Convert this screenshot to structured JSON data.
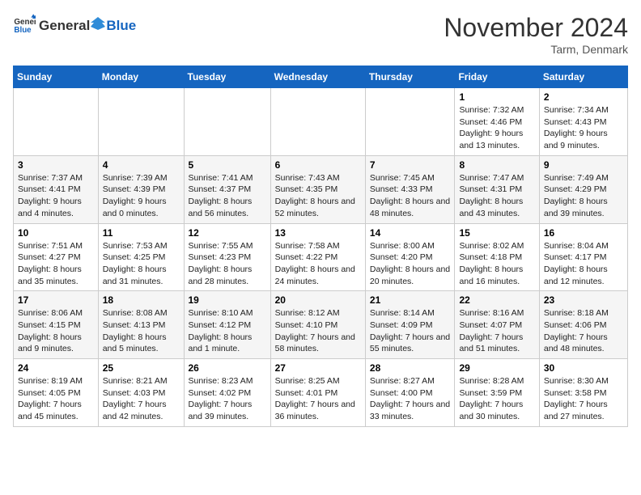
{
  "header": {
    "logo_general": "General",
    "logo_blue": "Blue",
    "month_title": "November 2024",
    "location": "Tarm, Denmark"
  },
  "days_of_week": [
    "Sunday",
    "Monday",
    "Tuesday",
    "Wednesday",
    "Thursday",
    "Friday",
    "Saturday"
  ],
  "weeks": [
    [
      {
        "day": "",
        "info": ""
      },
      {
        "day": "",
        "info": ""
      },
      {
        "day": "",
        "info": ""
      },
      {
        "day": "",
        "info": ""
      },
      {
        "day": "",
        "info": ""
      },
      {
        "day": "1",
        "info": "Sunrise: 7:32 AM\nSunset: 4:46 PM\nDaylight: 9 hours and 13 minutes."
      },
      {
        "day": "2",
        "info": "Sunrise: 7:34 AM\nSunset: 4:43 PM\nDaylight: 9 hours and 9 minutes."
      }
    ],
    [
      {
        "day": "3",
        "info": "Sunrise: 7:37 AM\nSunset: 4:41 PM\nDaylight: 9 hours and 4 minutes."
      },
      {
        "day": "4",
        "info": "Sunrise: 7:39 AM\nSunset: 4:39 PM\nDaylight: 9 hours and 0 minutes."
      },
      {
        "day": "5",
        "info": "Sunrise: 7:41 AM\nSunset: 4:37 PM\nDaylight: 8 hours and 56 minutes."
      },
      {
        "day": "6",
        "info": "Sunrise: 7:43 AM\nSunset: 4:35 PM\nDaylight: 8 hours and 52 minutes."
      },
      {
        "day": "7",
        "info": "Sunrise: 7:45 AM\nSunset: 4:33 PM\nDaylight: 8 hours and 48 minutes."
      },
      {
        "day": "8",
        "info": "Sunrise: 7:47 AM\nSunset: 4:31 PM\nDaylight: 8 hours and 43 minutes."
      },
      {
        "day": "9",
        "info": "Sunrise: 7:49 AM\nSunset: 4:29 PM\nDaylight: 8 hours and 39 minutes."
      }
    ],
    [
      {
        "day": "10",
        "info": "Sunrise: 7:51 AM\nSunset: 4:27 PM\nDaylight: 8 hours and 35 minutes."
      },
      {
        "day": "11",
        "info": "Sunrise: 7:53 AM\nSunset: 4:25 PM\nDaylight: 8 hours and 31 minutes."
      },
      {
        "day": "12",
        "info": "Sunrise: 7:55 AM\nSunset: 4:23 PM\nDaylight: 8 hours and 28 minutes."
      },
      {
        "day": "13",
        "info": "Sunrise: 7:58 AM\nSunset: 4:22 PM\nDaylight: 8 hours and 24 minutes."
      },
      {
        "day": "14",
        "info": "Sunrise: 8:00 AM\nSunset: 4:20 PM\nDaylight: 8 hours and 20 minutes."
      },
      {
        "day": "15",
        "info": "Sunrise: 8:02 AM\nSunset: 4:18 PM\nDaylight: 8 hours and 16 minutes."
      },
      {
        "day": "16",
        "info": "Sunrise: 8:04 AM\nSunset: 4:17 PM\nDaylight: 8 hours and 12 minutes."
      }
    ],
    [
      {
        "day": "17",
        "info": "Sunrise: 8:06 AM\nSunset: 4:15 PM\nDaylight: 8 hours and 9 minutes."
      },
      {
        "day": "18",
        "info": "Sunrise: 8:08 AM\nSunset: 4:13 PM\nDaylight: 8 hours and 5 minutes."
      },
      {
        "day": "19",
        "info": "Sunrise: 8:10 AM\nSunset: 4:12 PM\nDaylight: 8 hours and 1 minute."
      },
      {
        "day": "20",
        "info": "Sunrise: 8:12 AM\nSunset: 4:10 PM\nDaylight: 7 hours and 58 minutes."
      },
      {
        "day": "21",
        "info": "Sunrise: 8:14 AM\nSunset: 4:09 PM\nDaylight: 7 hours and 55 minutes."
      },
      {
        "day": "22",
        "info": "Sunrise: 8:16 AM\nSunset: 4:07 PM\nDaylight: 7 hours and 51 minutes."
      },
      {
        "day": "23",
        "info": "Sunrise: 8:18 AM\nSunset: 4:06 PM\nDaylight: 7 hours and 48 minutes."
      }
    ],
    [
      {
        "day": "24",
        "info": "Sunrise: 8:19 AM\nSunset: 4:05 PM\nDaylight: 7 hours and 45 minutes."
      },
      {
        "day": "25",
        "info": "Sunrise: 8:21 AM\nSunset: 4:03 PM\nDaylight: 7 hours and 42 minutes."
      },
      {
        "day": "26",
        "info": "Sunrise: 8:23 AM\nSunset: 4:02 PM\nDaylight: 7 hours and 39 minutes."
      },
      {
        "day": "27",
        "info": "Sunrise: 8:25 AM\nSunset: 4:01 PM\nDaylight: 7 hours and 36 minutes."
      },
      {
        "day": "28",
        "info": "Sunrise: 8:27 AM\nSunset: 4:00 PM\nDaylight: 7 hours and 33 minutes."
      },
      {
        "day": "29",
        "info": "Sunrise: 8:28 AM\nSunset: 3:59 PM\nDaylight: 7 hours and 30 minutes."
      },
      {
        "day": "30",
        "info": "Sunrise: 8:30 AM\nSunset: 3:58 PM\nDaylight: 7 hours and 27 minutes."
      }
    ]
  ]
}
